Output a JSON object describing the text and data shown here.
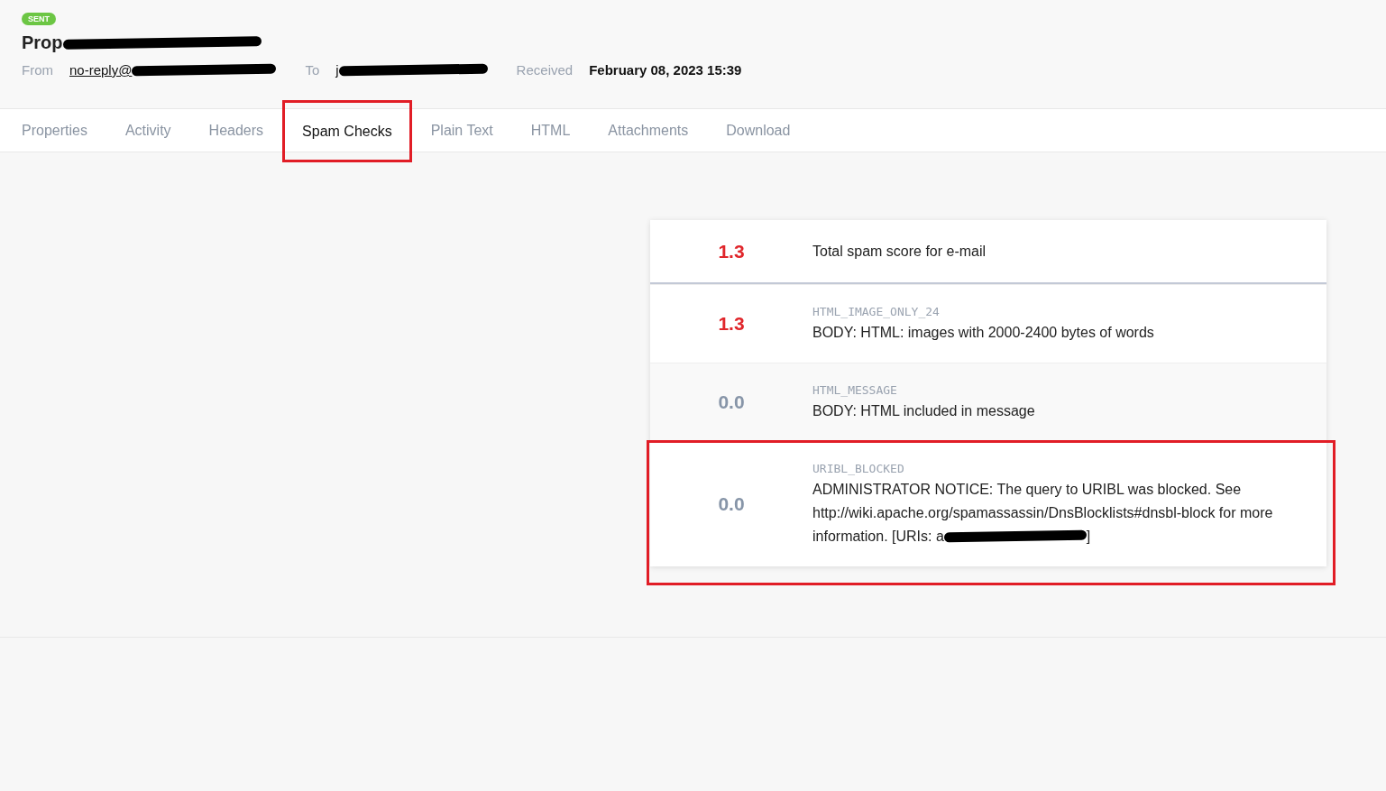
{
  "message": {
    "status": "SENT",
    "title": "Prop",
    "title_redacted": true,
    "from_label": "From",
    "from": "no-reply@",
    "from_redacted": true,
    "to_label": "To",
    "to": "j",
    "to_redacted": true,
    "received_label": "Received",
    "received": "February 08, 2023 15:39"
  },
  "tabs": [
    {
      "label": "Properties",
      "selected": false,
      "highlighted": false
    },
    {
      "label": "Activity",
      "selected": false,
      "highlighted": false
    },
    {
      "label": "Headers",
      "selected": false,
      "highlighted": false
    },
    {
      "label": "Spam Checks",
      "selected": true,
      "highlighted": true
    },
    {
      "label": "Plain Text",
      "selected": false,
      "highlighted": false
    },
    {
      "label": "HTML",
      "selected": false,
      "highlighted": false
    },
    {
      "label": "Attachments",
      "selected": false,
      "highlighted": false
    },
    {
      "label": "Download",
      "selected": false,
      "highlighted": false
    }
  ],
  "spam_checks": {
    "total": {
      "score": "1.3",
      "color": "#e0262b",
      "label": "Total spam score for e-mail"
    },
    "rules": [
      {
        "score": "1.3",
        "color": "#e0262b",
        "name": "HTML_IMAGE_ONLY_24",
        "description": "BODY: HTML: images with 2000-2400 bytes of words",
        "highlighted": false
      },
      {
        "score": "0.0",
        "color": "#8795a8",
        "name": "HTML_MESSAGE",
        "description": "BODY: HTML included in message",
        "highlighted": false
      },
      {
        "score": "0.0",
        "color": "#8795a8",
        "name": "URIBL_BLOCKED",
        "description": "ADMINISTRATOR NOTICE: The query to URIBL was blocked. See http://wiki.apache.org/spamassassin/DnsBlocklists#dnsbl-block for more information. [URIs: a",
        "redacted": true,
        "suffix": "]",
        "highlighted": true
      }
    ]
  }
}
